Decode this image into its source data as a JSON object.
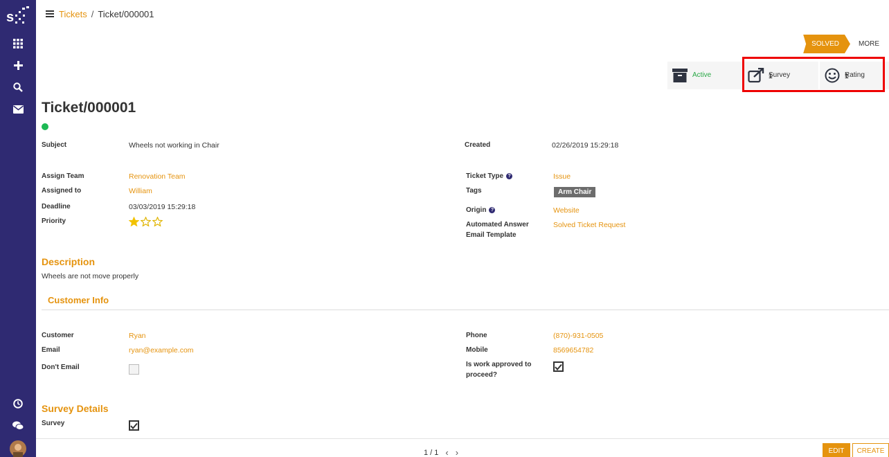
{
  "breadcrumb": {
    "parent": "Tickets",
    "separator": "/",
    "current": "Ticket/000001"
  },
  "stages": {
    "active": "SOLVED",
    "more": "MORE"
  },
  "smart_buttons": {
    "active": {
      "label": "Active"
    },
    "survey": {
      "value": "1",
      "label": "Survey"
    },
    "rating": {
      "value": "1",
      "label": "Rating"
    }
  },
  "ticket": {
    "title": "Ticket/000001",
    "left": {
      "subject_label": "Subject",
      "subject": "Wheels not working in Chair",
      "team_label": "Assign Team",
      "team": "Renovation Team",
      "assigned_label": "Assigned to",
      "assigned": "William",
      "deadline_label": "Deadline",
      "deadline": "03/03/2019 15:29:18",
      "priority_label": "Priority",
      "priority_stars": 1,
      "priority_max": 3
    },
    "right": {
      "created_label": "Created",
      "created": "02/26/2019 15:29:18",
      "type_label": "Ticket Type",
      "type": "Issue",
      "tags_label": "Tags",
      "tag": "Arm Chair",
      "origin_label": "Origin",
      "origin": "Website",
      "template_label_1": "Automated Answer",
      "template_label_2": "Email Template",
      "template": "Solved Ticket Request"
    }
  },
  "description": {
    "heading": "Description",
    "text": "Wheels are not move properly"
  },
  "customer": {
    "heading": "Customer Info",
    "customer_label": "Customer",
    "customer": "Ryan",
    "email_label": "Email",
    "email": "ryan@example.com",
    "dont_email_label": "Don't Email",
    "dont_email": false,
    "phone_label": "Phone",
    "phone": "(870)-931-0505",
    "mobile_label": "Mobile",
    "mobile": "8569654782",
    "approved_label_1": "Is work approved to",
    "approved_label_2": "proceed?",
    "approved": true
  },
  "survey": {
    "heading": "Survey Details",
    "survey_label": "Survey",
    "survey": true
  },
  "pager": {
    "text": "1 / 1"
  },
  "actions": {
    "edit": "EDIT",
    "create": "CREATE"
  },
  "colors": {
    "accent": "#e5930e",
    "sidebar": "#2f2a72",
    "active": "#28a745"
  }
}
